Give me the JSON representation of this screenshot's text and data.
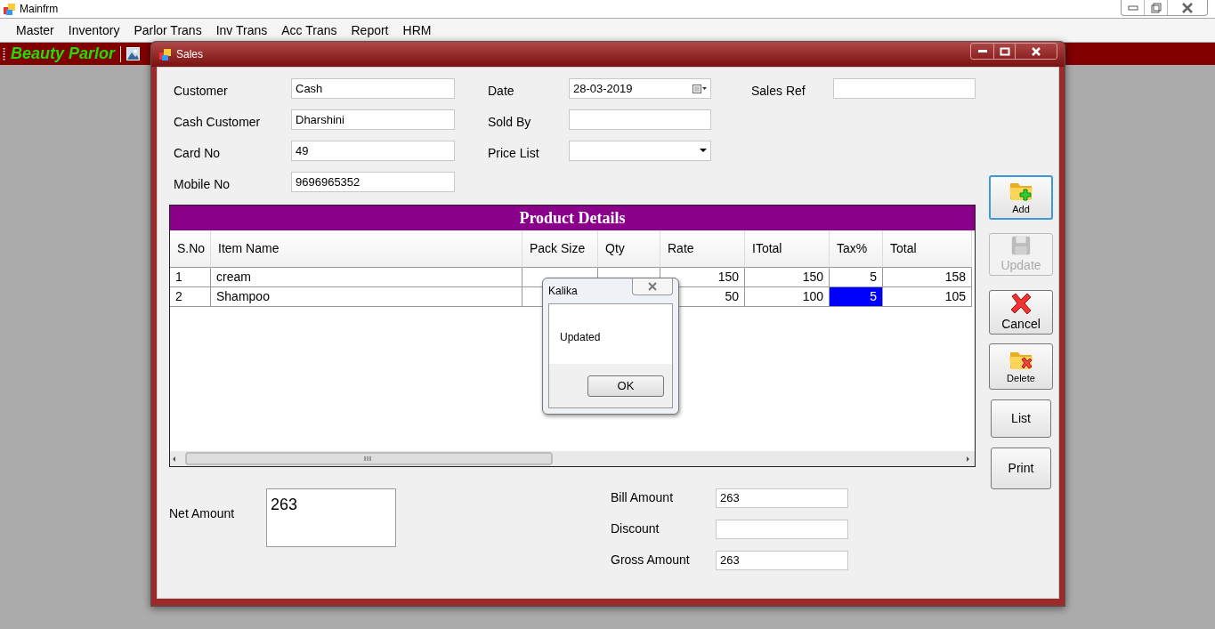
{
  "main_window": {
    "title": "Mainfrm"
  },
  "menu": [
    "Master",
    "Inventory",
    "Parlor Trans",
    "Inv Trans",
    "Acc Trans",
    "Report",
    "HRM"
  ],
  "toolbar": {
    "title": "Beauty Parlor"
  },
  "sales_window": {
    "title": "Sales"
  },
  "fields": [
    {
      "label": "Customer",
      "value": "Cash",
      "kind": "text"
    },
    {
      "label": "Date",
      "value": "28-03-2019",
      "kind": "date"
    },
    {
      "label": "Sales Ref",
      "kind": "text"
    },
    {
      "label": "Cash Customer",
      "value": "Dharshini",
      "kind": "text"
    },
    {
      "label": "Sold By",
      "kind": "text"
    },
    {
      "label": "Card No",
      "value": "49",
      "kind": "text"
    },
    {
      "label": "Price List",
      "kind": "combo"
    },
    {
      "label": "Mobile No",
      "value": "9696965352",
      "kind": "text"
    }
  ],
  "product_details": {
    "title": "Product Details",
    "columns": [
      "S.No",
      "Item Name",
      "Pack Size",
      "Qty",
      "Rate",
      "ITotal",
      "Tax%",
      "Total"
    ],
    "rows": [
      {
        "cells": [
          {
            "text": "1",
            "selected": false
          },
          {
            "text": "cream",
            "selected": false
          },
          null,
          null,
          {
            "text": "150",
            "selected": false
          },
          {
            "text": "150",
            "selected": false
          },
          {
            "text": "5",
            "selected": false
          },
          {
            "text": "158",
            "selected": false
          }
        ]
      },
      {
        "cells": [
          {
            "text": "2",
            "selected": false
          },
          {
            "text": "Shampoo",
            "selected": false
          },
          null,
          null,
          {
            "text": "50",
            "selected": false
          },
          {
            "text": "100",
            "selected": false
          },
          {
            "text": "5",
            "selected": true
          },
          {
            "text": "105",
            "selected": false
          }
        ]
      }
    ]
  },
  "buttons": [
    {
      "label": "Add",
      "focused": true,
      "disabled": false
    },
    {
      "label": "Update",
      "focused": false,
      "disabled": true
    },
    {
      "label": "Cancel",
      "focused": false,
      "disabled": false
    },
    {
      "label": "Delete",
      "focused": false,
      "disabled": false
    },
    {
      "label": "List",
      "focused": false,
      "disabled": false
    },
    {
      "label": "Print",
      "focused": false,
      "disabled": false
    }
  ],
  "net_amount": {
    "label": "Net Amount",
    "value": "263"
  },
  "amounts": [
    {
      "label": "Bill Amount",
      "value": "263"
    },
    {
      "label": "Discount"
    },
    {
      "label": "Gross Amount",
      "value": "263"
    }
  ],
  "dialog": {
    "title": "Kalika",
    "message": "Updated",
    "button": "OK"
  }
}
